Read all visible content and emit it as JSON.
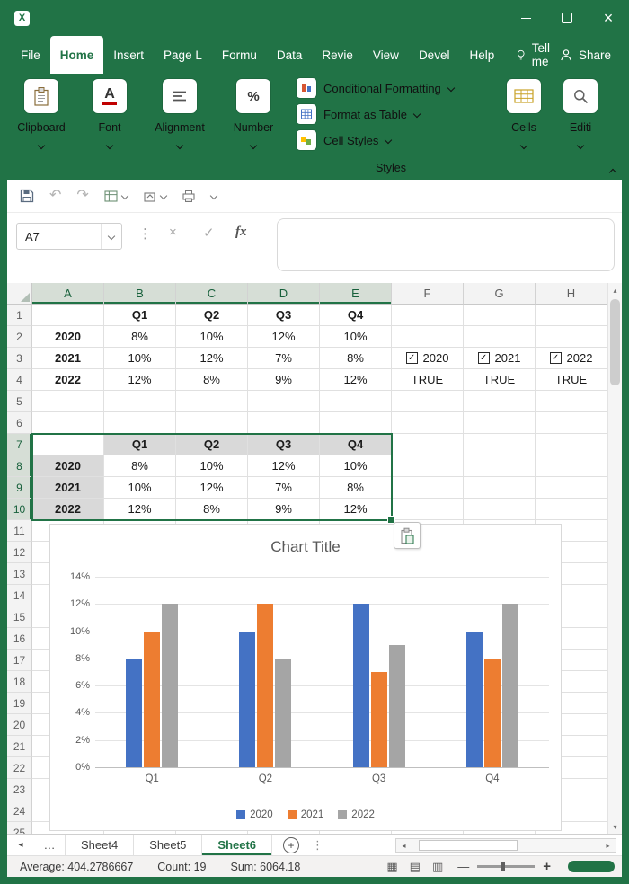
{
  "colors": {
    "accent_green": "#217346",
    "selection_border": "#217346",
    "gray_fill": "#d9d9d9"
  },
  "glyphs": {
    "close": "×",
    "undo": "↶",
    "redo": "↷",
    "cancel": "×",
    "enter": "✓",
    "dots": "⋮",
    "ellipsis": "…",
    "up": "▴",
    "down": "▾",
    "left": "◂",
    "right": "▸",
    "plus": "+",
    "minus": "—",
    "view_normal": "▦",
    "view_layout": "▤",
    "view_break": "▥"
  },
  "menubar": {
    "tabs": [
      {
        "label": "File",
        "active": false
      },
      {
        "label": "Home",
        "active": true
      },
      {
        "label": "Insert",
        "active": false
      },
      {
        "label": "Page L",
        "active": false
      },
      {
        "label": "Formu",
        "active": false
      },
      {
        "label": "Data",
        "active": false
      },
      {
        "label": "Revie",
        "active": false
      },
      {
        "label": "View",
        "active": false
      },
      {
        "label": "Devel",
        "active": false
      },
      {
        "label": "Help",
        "active": false
      }
    ],
    "tell_me": "Tell me",
    "share": "Share"
  },
  "ribbon": {
    "groups": [
      {
        "label": "Clipboard"
      },
      {
        "label": "Font"
      },
      {
        "label": "Alignment"
      },
      {
        "label": "Number"
      }
    ],
    "styles": {
      "items": [
        "Conditional Formatting",
        "Format as Table",
        "Cell Styles"
      ],
      "label": "Styles"
    },
    "cells_label": "Cells",
    "editing_label": "Editi"
  },
  "formula_bar": {
    "name_box_value": "A7",
    "fx_label": "fx",
    "formula_value": ""
  },
  "grid": {
    "column_headers": [
      "A",
      "B",
      "C",
      "D",
      "E",
      "F",
      "G",
      "H"
    ],
    "selected_columns": [
      "A",
      "B",
      "C",
      "D",
      "E"
    ],
    "row_count": 25,
    "selected_rows": [
      7,
      8,
      9,
      10
    ],
    "selection": {
      "range": "A7:E10",
      "active_cell": "A7"
    },
    "cells": [
      {
        "ref": "B1",
        "v": "Q1",
        "bold": true
      },
      {
        "ref": "C1",
        "v": "Q2",
        "bold": true
      },
      {
        "ref": "D1",
        "v": "Q3",
        "bold": true
      },
      {
        "ref": "E1",
        "v": "Q4",
        "bold": true
      },
      {
        "ref": "A2",
        "v": "2020",
        "bold": true
      },
      {
        "ref": "B2",
        "v": "8%"
      },
      {
        "ref": "C2",
        "v": "10%"
      },
      {
        "ref": "D2",
        "v": "12%"
      },
      {
        "ref": "E2",
        "v": "10%"
      },
      {
        "ref": "A3",
        "v": "2021",
        "bold": true
      },
      {
        "ref": "B3",
        "v": "10%"
      },
      {
        "ref": "C3",
        "v": "12%"
      },
      {
        "ref": "D3",
        "v": "7%"
      },
      {
        "ref": "E3",
        "v": "8%"
      },
      {
        "ref": "A4",
        "v": "2022",
        "bold": true
      },
      {
        "ref": "B4",
        "v": "12%"
      },
      {
        "ref": "C4",
        "v": "8%"
      },
      {
        "ref": "D4",
        "v": "9%"
      },
      {
        "ref": "E4",
        "v": "12%"
      },
      {
        "ref": "F4",
        "v": "TRUE"
      },
      {
        "ref": "G4",
        "v": "TRUE"
      },
      {
        "ref": "H4",
        "v": "TRUE"
      },
      {
        "ref": "B7",
        "v": "Q1",
        "bold": true,
        "fill": "gray"
      },
      {
        "ref": "C7",
        "v": "Q2",
        "bold": true,
        "fill": "gray"
      },
      {
        "ref": "D7",
        "v": "Q3",
        "bold": true,
        "fill": "gray"
      },
      {
        "ref": "E7",
        "v": "Q4",
        "bold": true,
        "fill": "gray"
      },
      {
        "ref": "A8",
        "v": "2020",
        "bold": true,
        "fill": "gray"
      },
      {
        "ref": "B8",
        "v": "8%"
      },
      {
        "ref": "C8",
        "v": "10%"
      },
      {
        "ref": "D8",
        "v": "12%"
      },
      {
        "ref": "E8",
        "v": "10%"
      },
      {
        "ref": "A9",
        "v": "2021",
        "bold": true,
        "fill": "gray"
      },
      {
        "ref": "B9",
        "v": "10%"
      },
      {
        "ref": "C9",
        "v": "12%"
      },
      {
        "ref": "D9",
        "v": "7%"
      },
      {
        "ref": "E9",
        "v": "8%"
      },
      {
        "ref": "A10",
        "v": "2022",
        "bold": true,
        "fill": "gray"
      },
      {
        "ref": "B10",
        "v": "12%"
      },
      {
        "ref": "C10",
        "v": "8%"
      },
      {
        "ref": "D10",
        "v": "9%"
      },
      {
        "ref": "E10",
        "v": "12%"
      }
    ],
    "checkbox_cells": [
      {
        "ref": "F3",
        "label": "2020",
        "checked": true
      },
      {
        "ref": "G3",
        "label": "2021",
        "checked": true
      },
      {
        "ref": "H3",
        "label": "2022",
        "checked": true
      }
    ]
  },
  "chart_data": {
    "type": "bar",
    "title": "Chart Title",
    "categories": [
      "Q1",
      "Q2",
      "Q3",
      "Q4"
    ],
    "series": [
      {
        "name": "2020",
        "color": "#4472C4",
        "values": [
          8,
          10,
          12,
          10
        ]
      },
      {
        "name": "2021",
        "color": "#ED7D31",
        "values": [
          10,
          12,
          7,
          8
        ]
      },
      {
        "name": "2022",
        "color": "#A5A5A5",
        "values": [
          12,
          8,
          9,
          12
        ]
      }
    ],
    "value_format": "percent",
    "ylim": [
      0,
      14
    ],
    "ytick_step": 2,
    "ytick_labels": [
      "0%",
      "2%",
      "4%",
      "6%",
      "8%",
      "10%",
      "12%",
      "14%"
    ],
    "grid": true,
    "legend_position": "bottom"
  },
  "sheet_bar": {
    "overflow": "…",
    "tabs": [
      {
        "label": "Sheet4",
        "active": false
      },
      {
        "label": "Sheet5",
        "active": false
      },
      {
        "label": "Sheet6",
        "active": true
      }
    ]
  },
  "status_bar": {
    "items": [
      "Average: 404.2786667",
      "Count: 19",
      "Sum: 6064.18"
    ]
  }
}
